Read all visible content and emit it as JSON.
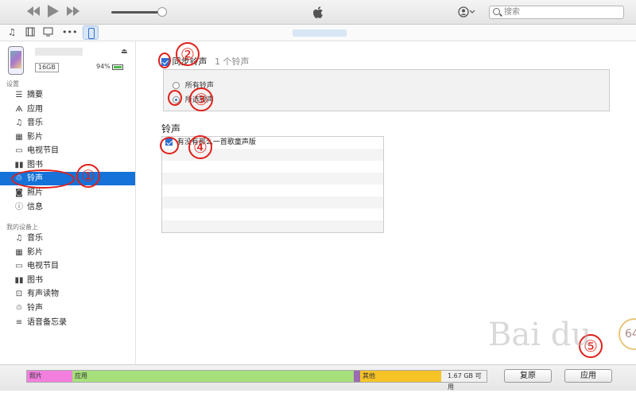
{
  "toolbar": {
    "search_placeholder": "搜索"
  },
  "device": {
    "capacity": "16GB",
    "battery": "94%"
  },
  "sidebar": {
    "settings_label": "设置",
    "settings_items": [
      {
        "label": "摘要",
        "icon": "summary-icon"
      },
      {
        "label": "应用",
        "icon": "apps-icon"
      },
      {
        "label": "音乐",
        "icon": "music-icon"
      },
      {
        "label": "影片",
        "icon": "film-icon"
      },
      {
        "label": "电视节目",
        "icon": "tv-icon"
      },
      {
        "label": "图书",
        "icon": "book-icon"
      },
      {
        "label": "铃声",
        "icon": "bell-icon",
        "active": true
      },
      {
        "label": "照片",
        "icon": "camera-icon"
      },
      {
        "label": "信息",
        "icon": "info-icon"
      }
    ],
    "ondevice_label": "我的设备上",
    "ondevice_items": [
      {
        "label": "音乐",
        "icon": "music-icon"
      },
      {
        "label": "影片",
        "icon": "film-icon"
      },
      {
        "label": "电视节目",
        "icon": "tv-icon"
      },
      {
        "label": "图书",
        "icon": "book-icon"
      },
      {
        "label": "有声读物",
        "icon": "audiobook-icon"
      },
      {
        "label": "铃声",
        "icon": "bell-icon"
      },
      {
        "label": "语音备忘录",
        "icon": "voice-memo-icon"
      }
    ]
  },
  "main": {
    "sync_label": "同步铃声",
    "sync_count": "1 个铃声",
    "radio_all": "所有铃声",
    "radio_selected": "所选铃声",
    "section_title": "铃声",
    "ringtones": [
      "有没有那么一首歌童声版"
    ]
  },
  "annotations": [
    "①",
    "②",
    "③",
    "④",
    "⑤"
  ],
  "bottom": {
    "segments": [
      {
        "label": "照片",
        "color": "#f27fde"
      },
      {
        "label": "应用",
        "color": "#a6e07a"
      },
      {
        "label": "其他",
        "color": "#f5c326"
      },
      {
        "label": "1.67 GB 可用",
        "color": "#f0f0f0"
      }
    ],
    "revert_label": "复原",
    "apply_label": "应用"
  },
  "watermark": "Bai du",
  "badge": "64",
  "colors": {
    "accent": "#1472d8",
    "annotation": "#e0201a"
  }
}
